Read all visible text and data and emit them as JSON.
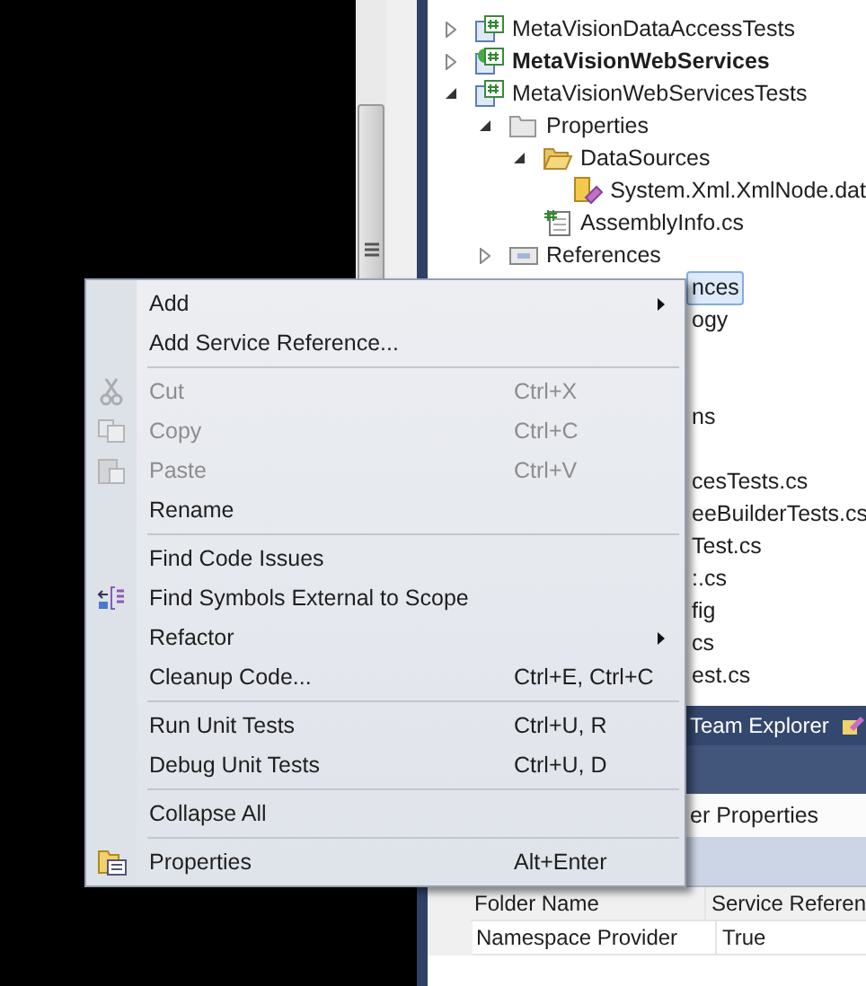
{
  "solution_explorer": {
    "tree": [
      {
        "label": "MetaVisionDataAccessTests",
        "kind": "project",
        "expanded": false,
        "bold": false
      },
      {
        "label": "MetaVisionWebServices",
        "kind": "webproject",
        "expanded": false,
        "bold": true
      },
      {
        "label": "MetaVisionWebServicesTests",
        "kind": "project",
        "expanded": true,
        "bold": false,
        "children": [
          {
            "label": "Properties",
            "kind": "folder",
            "expanded": true,
            "bold": false,
            "children": [
              {
                "label": "DataSources",
                "kind": "openfolder",
                "expanded": true,
                "bold": false,
                "children": [
                  {
                    "label": "System.Xml.XmlNode.dat",
                    "kind": "datasource",
                    "bold": false
                  }
                ]
              },
              {
                "label": "AssemblyInfo.cs",
                "kind": "csfile",
                "bold": false
              }
            ]
          },
          {
            "label": "References",
            "kind": "references",
            "expanded": false,
            "bold": false
          }
        ]
      }
    ],
    "covered_rows": [
      {
        "kind": "fragment",
        "text": "nces",
        "selected": true
      },
      {
        "kind": "fragment",
        "text": "ogy",
        "selected": false
      },
      {
        "kind": "covered"
      },
      {
        "kind": "covered"
      },
      {
        "kind": "fragment",
        "text": "ns",
        "selected": false
      },
      {
        "kind": "covered"
      },
      {
        "kind": "fragment",
        "text": "cesTests.cs",
        "selected": false
      },
      {
        "kind": "fragment",
        "text": "eeBuilderTests.cs",
        "selected": false
      },
      {
        "kind": "fragment",
        "text": "Test.cs",
        "selected": false
      },
      {
        "kind": "fragment",
        "text": ":.cs",
        "selected": false
      },
      {
        "kind": "fragment",
        "text": "fig",
        "selected": false
      },
      {
        "kind": "fragment",
        "text": "cs",
        "selected": false
      },
      {
        "kind": "fragment",
        "text": "est.cs",
        "selected": false
      }
    ]
  },
  "team_explorer_tab": {
    "label": "Team Explorer"
  },
  "properties_panel": {
    "title": "er Properties",
    "rows": [
      {
        "name": "Folder Name",
        "value": "Service Referen",
        "selected": true
      },
      {
        "name": "Namespace Provider",
        "value": "True",
        "selected": false
      }
    ]
  },
  "context_menu": {
    "items": [
      {
        "kind": "item",
        "label": "Add",
        "submenu": true,
        "disabled": false
      },
      {
        "kind": "item",
        "label": "Add Service Reference...",
        "submenu": false,
        "disabled": false
      },
      {
        "kind": "separator"
      },
      {
        "kind": "item",
        "label": "Cut",
        "shortcut": "Ctrl+X",
        "submenu": false,
        "disabled": true
      },
      {
        "kind": "item",
        "label": "Copy",
        "shortcut": "Ctrl+C",
        "submenu": false,
        "disabled": true
      },
      {
        "kind": "item",
        "label": "Paste",
        "shortcut": "Ctrl+V",
        "submenu": false,
        "disabled": true
      },
      {
        "kind": "item",
        "label": "Rename",
        "submenu": false,
        "disabled": false
      },
      {
        "kind": "separator"
      },
      {
        "kind": "item",
        "label": "Find Code Issues",
        "submenu": false,
        "disabled": false
      },
      {
        "kind": "item",
        "label": "Find Symbols External to Scope",
        "submenu": false,
        "disabled": false
      },
      {
        "kind": "item",
        "label": "Refactor",
        "submenu": true,
        "disabled": false
      },
      {
        "kind": "item",
        "label": "Cleanup Code...",
        "shortcut": "Ctrl+E, Ctrl+C",
        "submenu": false,
        "disabled": false
      },
      {
        "kind": "separator"
      },
      {
        "kind": "item",
        "label": "Run Unit Tests",
        "shortcut": "Ctrl+U, R",
        "submenu": false,
        "disabled": false
      },
      {
        "kind": "item",
        "label": "Debug Unit Tests",
        "shortcut": "Ctrl+U, D",
        "submenu": false,
        "disabled": false
      },
      {
        "kind": "separator"
      },
      {
        "kind": "item",
        "label": "Collapse All",
        "submenu": false,
        "disabled": false
      },
      {
        "kind": "separator"
      },
      {
        "kind": "item",
        "label": "Properties",
        "shortcut": "Alt+Enter",
        "submenu": false,
        "disabled": false
      }
    ]
  }
}
